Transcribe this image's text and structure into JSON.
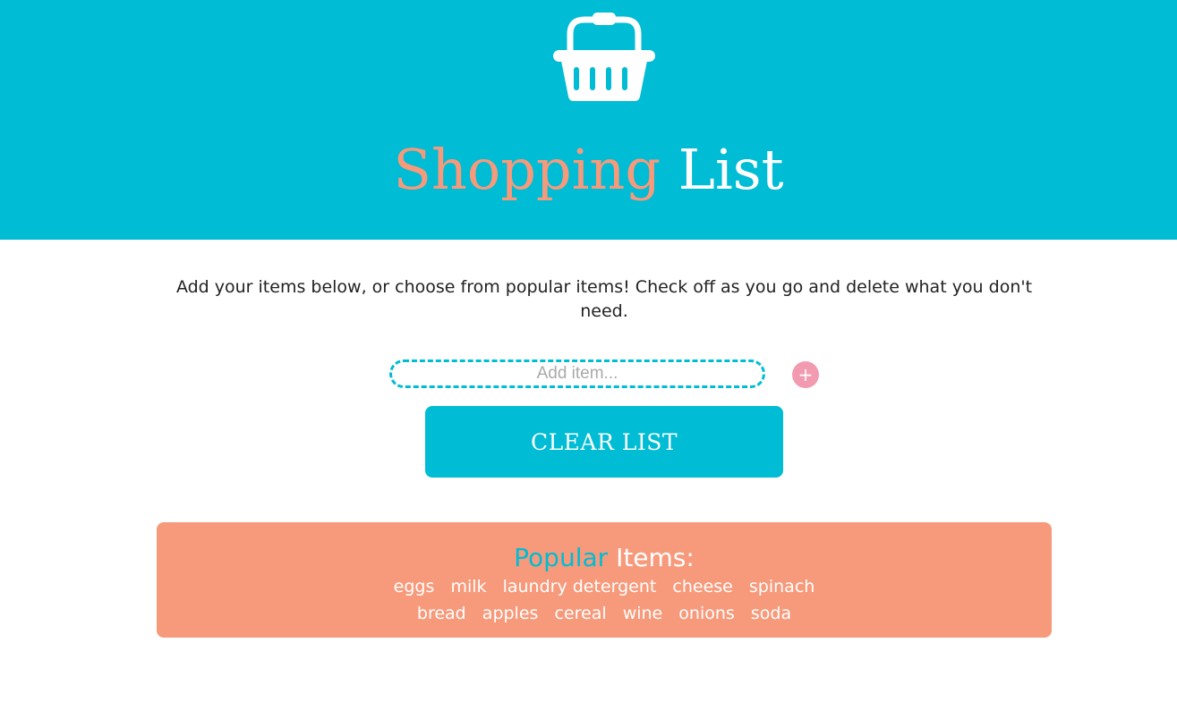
{
  "header": {
    "title_part1": "Shopping",
    "title_part2": "List",
    "icon": "basket-icon",
    "background_color": "#00bcd4",
    "title_accent_color": "#f79a7b"
  },
  "intro": {
    "text": "Add your items below, or choose from popular items! Check off as you go and delete what you don't need."
  },
  "add_item": {
    "placeholder": "Add item...",
    "value": "",
    "add_button_label": "+",
    "add_button_color": "#f29bb0"
  },
  "clear_button": {
    "label": "CLEAR LIST"
  },
  "popular": {
    "title_part1": "Popular",
    "title_part2": "Items:",
    "background_color": "#f79a7b",
    "row1": [
      "eggs",
      "milk",
      "laundry detergent",
      "cheese",
      "spinach"
    ],
    "row2": [
      "bread",
      "apples",
      "cereal",
      "wine",
      "onions",
      "soda"
    ]
  }
}
